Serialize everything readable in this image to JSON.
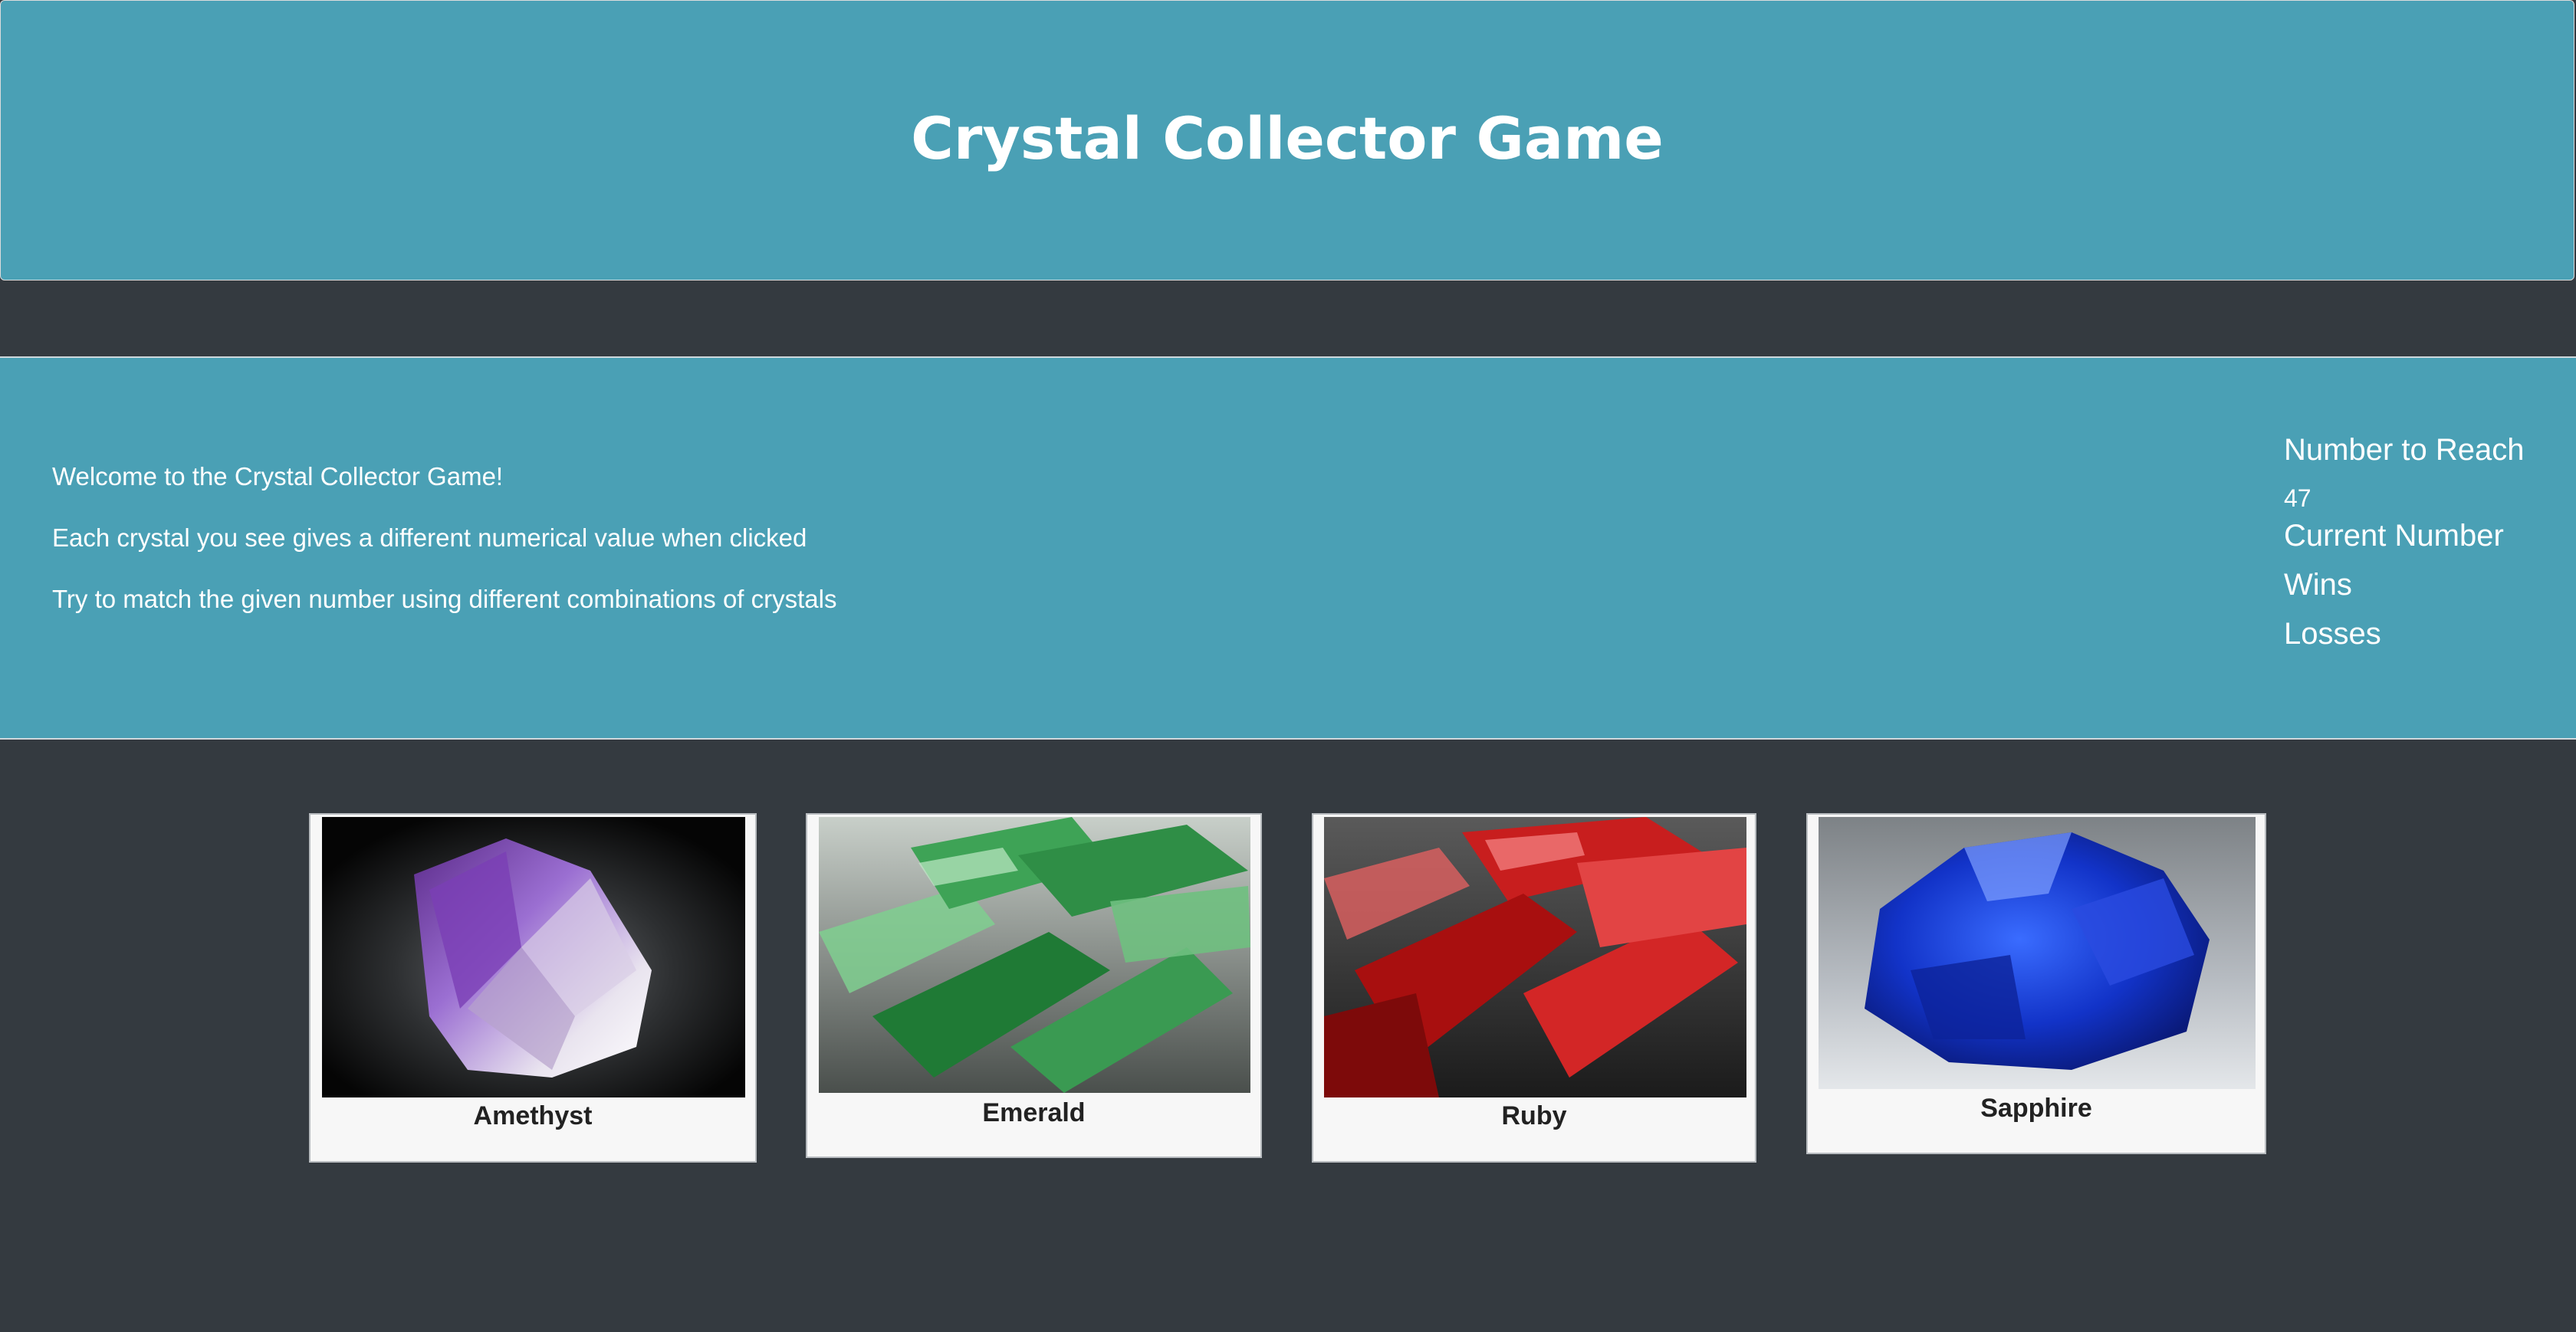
{
  "header": {
    "title": "Crystal Collector Game"
  },
  "instructions": [
    "Welcome to the Crystal Collector Game!",
    "Each crystal you see gives a different numerical value when clicked",
    "Try to match the given number using different combinations of crystals"
  ],
  "scoreboard": {
    "target_label": "Number to Reach",
    "target_value": "47",
    "current_label": "Current Number",
    "wins_label": "Wins",
    "losses_label": "Losses"
  },
  "crystals": [
    {
      "name": "Amethyst",
      "color": "#8a4fc8"
    },
    {
      "name": "Emerald",
      "color": "#2f9e47"
    },
    {
      "name": "Ruby",
      "color": "#d11f1f"
    },
    {
      "name": "Sapphire",
      "color": "#1233c8"
    }
  ],
  "colors": {
    "panel": "#4aa0b5",
    "background": "#343a40"
  }
}
